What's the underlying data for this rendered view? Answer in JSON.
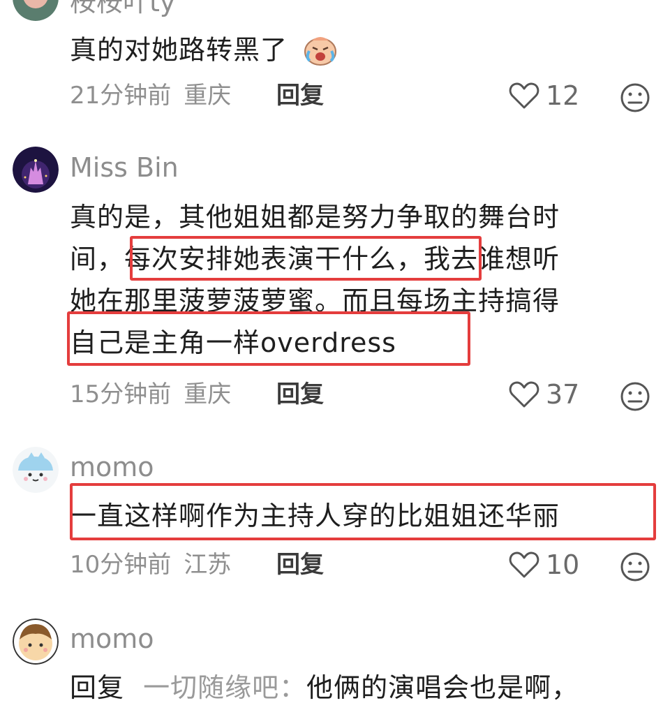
{
  "comments": [
    {
      "username": "桉桉叶ty",
      "lines": [
        "真的对她路转黑了"
      ],
      "time": "21分钟前",
      "location": "重庆",
      "reply_label": "回复",
      "likes": "12",
      "emoji": "crying-face-emoji"
    },
    {
      "username": "Miss Bin",
      "lines": [
        "真的是，其他姐姐都是努力争取的舞台时",
        "间，每次安排她表演干什么，我去谁想听",
        "她在那里菠萝菠萝蜜。而且每场主持搞得",
        "自己是主角一样overdress"
      ],
      "time": "15分钟前",
      "location": "重庆",
      "reply_label": "回复",
      "likes": "37"
    },
    {
      "username": "momo",
      "lines": [
        "一直这样啊作为主持人穿的比姐姐还华丽"
      ],
      "time": "10分钟前",
      "location": "江苏",
      "reply_label": "回复",
      "likes": "10"
    },
    {
      "username": "momo",
      "reply_prefix": "回复",
      "reply_target": "一切随缘吧：",
      "reply_text": "他俩的演唱会也是啊，"
    }
  ],
  "highlight_color": "#e43d3d",
  "icons": [
    "heart-outline-icon",
    "neutral-face-icon"
  ]
}
